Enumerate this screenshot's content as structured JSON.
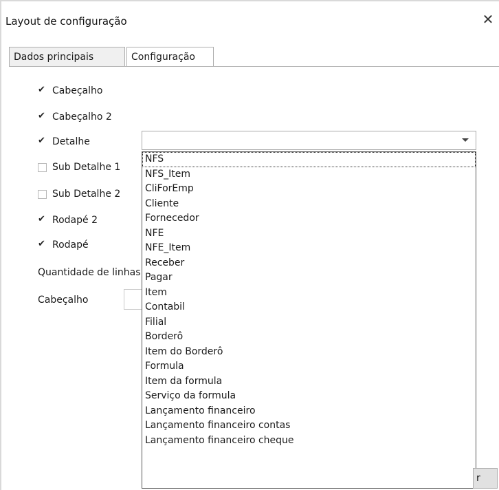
{
  "window": {
    "title": "Layout de configuração",
    "close_symbol": "✕"
  },
  "tabs": [
    {
      "label": "Dados principais",
      "active": false
    },
    {
      "label": "Configuração",
      "active": true
    }
  ],
  "checks": [
    {
      "label": "Cabeçalho",
      "checked": true
    },
    {
      "label": "Cabeçalho 2",
      "checked": true
    },
    {
      "label": "Detalhe",
      "checked": true
    },
    {
      "label": "Sub Detalhe 1",
      "checked": false
    },
    {
      "label": "Sub Detalhe 2",
      "checked": false
    },
    {
      "label": "Rodapé 2",
      "checked": true
    },
    {
      "label": "Rodapé",
      "checked": true
    }
  ],
  "quantidade_label": "Quantidade de linhas",
  "cabecalho_label": "Cabeçalho",
  "combo": {
    "value": ""
  },
  "dropdown": {
    "items": [
      "NFS",
      "NFS_Item",
      "CliForEmp",
      "Cliente",
      "Fornecedor",
      "NFE",
      "NFE_Item",
      "Receber",
      "Pagar",
      "Item",
      "Contabil",
      "Filial",
      "Borderô",
      "Item do Borderô",
      "Formula",
      "Item da formula",
      "Serviço da formula",
      "Lançamento financeiro",
      "Lançamento financeiro contas",
      "Lançamento financeiro cheque"
    ],
    "selected_index": 0
  },
  "partial_button": {
    "label": "r"
  }
}
